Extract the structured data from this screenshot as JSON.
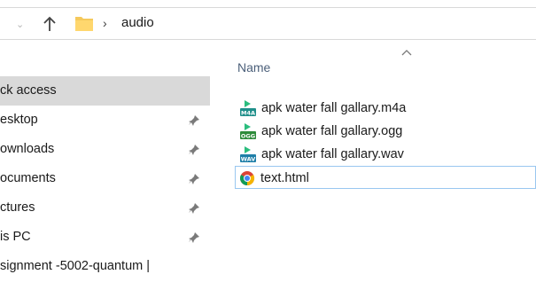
{
  "address_bar": {
    "current_folder": "audio",
    "separator": "›"
  },
  "nav_pane": {
    "items": [
      {
        "label": "ck access",
        "pinned": false,
        "selected": true
      },
      {
        "label": "esktop",
        "pinned": true,
        "selected": false
      },
      {
        "label": "ownloads",
        "pinned": true,
        "selected": false
      },
      {
        "label": "ocuments",
        "pinned": true,
        "selected": false
      },
      {
        "label": "ctures",
        "pinned": true,
        "selected": false
      },
      {
        "label": "is PC",
        "pinned": true,
        "selected": false
      },
      {
        "label": "signment -5002-quantum |",
        "pinned": false,
        "selected": false
      }
    ]
  },
  "content": {
    "column_header": "Name",
    "sort": "ascending",
    "files": [
      {
        "name": "apk water fall gallary.m4a",
        "icon": "m4a-audio-icon",
        "badge": "M4A"
      },
      {
        "name": "apk water fall gallary.ogg",
        "icon": "ogg-audio-icon",
        "badge": "OGG"
      },
      {
        "name": "apk water fall gallary.wav",
        "icon": "wav-audio-icon",
        "badge": "WAV"
      },
      {
        "name": "text.html",
        "icon": "chrome-icon",
        "badge": "",
        "focused": true
      }
    ]
  },
  "colors": {
    "selection": "#d9d9d9",
    "focus_border": "#99c7f0",
    "header_text": "#4c607a",
    "folder": "#f5c95c"
  }
}
